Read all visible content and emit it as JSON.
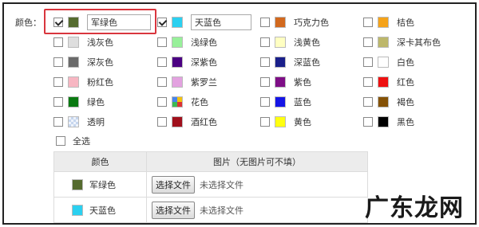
{
  "field_label": "颜色：",
  "colors": [
    {
      "name": "军绿色",
      "hex": "#556B2F",
      "checked": true,
      "editable": true
    },
    {
      "name": "天蓝色",
      "hex": "#2BD0F0",
      "checked": true,
      "editable": true
    },
    {
      "name": "巧克力色",
      "hex": "#D2691E",
      "checked": false
    },
    {
      "name": "桔色",
      "hex": "#F5A31A",
      "checked": false
    },
    {
      "name": "浅灰色",
      "hex": "#DEDEDE",
      "checked": false
    },
    {
      "name": "浅绿色",
      "hex": "#98F09A",
      "checked": false
    },
    {
      "name": "浅黄色",
      "hex": "#FFFFC2",
      "checked": false
    },
    {
      "name": "深卡其布色",
      "hex": "#BDB76B",
      "checked": false
    },
    {
      "name": "深灰色",
      "hex": "#6A6A6A",
      "checked": false
    },
    {
      "name": "深紫色",
      "hex": "#4B0082",
      "checked": false
    },
    {
      "name": "深蓝色",
      "hex": "#1A1F8A",
      "checked": false
    },
    {
      "name": "白色",
      "hex": "#FFFFFF",
      "checked": false
    },
    {
      "name": "粉红色",
      "hex": "#F7B6C2",
      "checked": false
    },
    {
      "name": "紫罗兰",
      "hex": "#E3A2E0",
      "checked": false
    },
    {
      "name": "紫色",
      "hex": "#7E0E86",
      "checked": false
    },
    {
      "name": "红色",
      "hex": "#EE1111",
      "checked": false
    },
    {
      "name": "绿色",
      "hex": "#0A7A12",
      "checked": false
    },
    {
      "name": "花色",
      "hex": "multicolor",
      "checked": false
    },
    {
      "name": "蓝色",
      "hex": "#1515E6",
      "checked": false
    },
    {
      "name": "褐色",
      "hex": "#855206",
      "checked": false
    },
    {
      "name": "透明",
      "hex": "transparent-pattern",
      "checked": false
    },
    {
      "name": "酒红色",
      "hex": "#A0101C",
      "checked": false
    },
    {
      "name": "黄色",
      "hex": "#FFFF10",
      "checked": false
    },
    {
      "name": "黑色",
      "hex": "#000000",
      "checked": false
    }
  ],
  "select_all_label": "全选",
  "table": {
    "headers": [
      "颜色",
      "图片（无图片可不填）"
    ],
    "rows": [
      {
        "color_name": "军绿色",
        "hex": "#556B2F",
        "button": "选择文件",
        "status": "未选择文件"
      },
      {
        "color_name": "天蓝色",
        "hex": "#2BD0F0",
        "button": "选择文件",
        "status": "未选择文件"
      }
    ]
  },
  "watermark": "广东龙网"
}
